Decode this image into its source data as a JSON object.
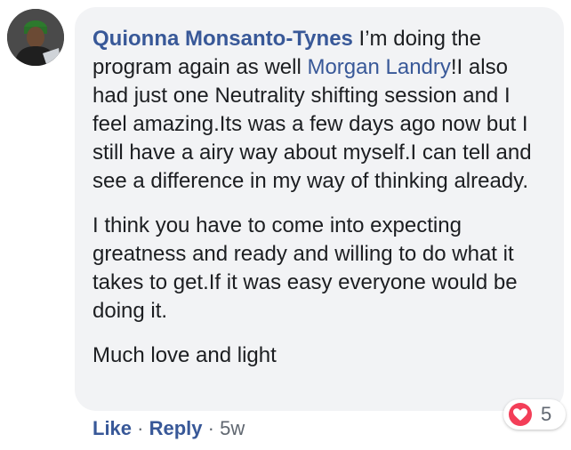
{
  "comment": {
    "author": "Quionna Monsanto-Tynes",
    "line1_rest": " I’m doing the program again as well ",
    "mention": "Morgan Landry",
    "line1_tail": "!I also had just one Neutrality shifting session and I feel amazing.Its was a few days ago now but I still have a airy way about myself.I can tell and see a difference in my way of thinking already.",
    "paragraph2": "I think you have to come into expecting greatness and ready and willing to do what it takes to get.If it was easy everyone would be doing it.",
    "paragraph3": "Much love and light"
  },
  "actions": {
    "like": "Like",
    "separator": "·",
    "reply": "Reply",
    "time": "5w"
  },
  "reaction": {
    "icon": "heart-icon",
    "count": "5",
    "color": "#f33e58"
  }
}
